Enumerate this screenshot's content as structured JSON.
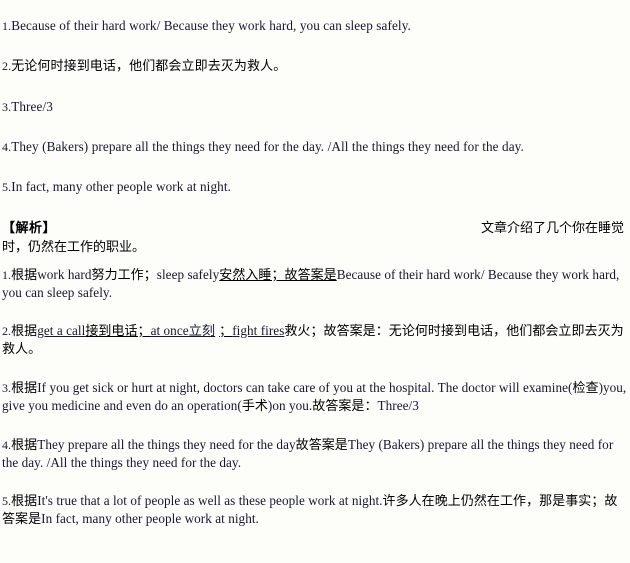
{
  "document": {
    "background_color": "#fdfdfa",
    "text_color": "#161632"
  },
  "answers": {
    "items": [
      {
        "num": "1.",
        "text": "Because of their hard work/ Because they work hard, you can sleep safely."
      },
      {
        "num": "2.",
        "text": "无论何时接到电话，他们都会立即去灭为救人。"
      },
      {
        "num": "3.",
        "text": "Three/3"
      },
      {
        "num": "4.",
        "text": "They (Bakers) prepare all the things they need for the day. /All the things they need for the day."
      },
      {
        "num": "5.",
        "text": "In fact, many other people work at night."
      }
    ]
  },
  "analysis": {
    "tag": "【解析】",
    "summary_line1": "文章介绍了几个你在睡觉",
    "summary_line2": "时，仍然在工作的职业。",
    "items": [
      {
        "num": "1.",
        "lead": "根据",
        "seg_a": "work hard",
        "seg_b": "努力工作；",
        "seg_c": "sleep safely",
        "seg_d_underlined": "安然入睡；故答案是",
        "answer": "Because of their hard work/ Because they work hard, you can sleep safely."
      },
      {
        "num": "2.",
        "lead": "根据",
        "u1": "get a call",
        "t1": "接到电话；",
        "u2": "at once立刻",
        "u3": "；",
        "u4": "fight fires",
        "t2": "救火；故答案是：无论何时接到电话，他们都会立即去灭为救人。"
      },
      {
        "num": "3.",
        "lead": "根据",
        "quote1": "If you get sick or hurt at night, doctors can take care of you at the hospital. The doctor will examine(",
        "gloss1": "检查",
        "quote2": ")you, give you medicine and even do an operation(",
        "gloss2": "手术",
        "quote3": ")on you.",
        "tail_cn": "故答案是：",
        "answer": "Three/3"
      },
      {
        "num": "4.",
        "lead": "根据",
        "quote": "They prepare all the things they need for the day",
        "tail_cn": "故答案是",
        "answer": "They (Bakers) prepare all the things they need for the day. /All the things they need for the day."
      },
      {
        "num": "5.",
        "lead": "根据",
        "quote": "It's true that a lot of people as well as these people work at night.",
        "gloss_cn": "许多人在晚上仍然在工作，那是事实；故答案是",
        "answer": "In fact, many other people work at night."
      }
    ]
  }
}
